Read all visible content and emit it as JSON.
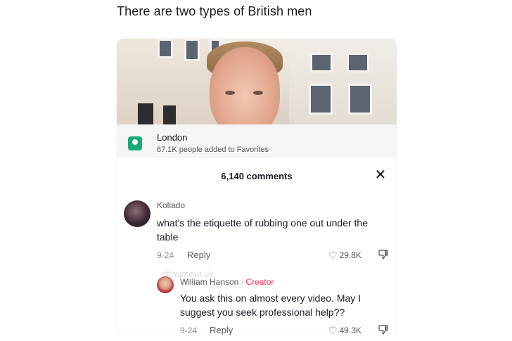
{
  "caption": "There are two types of British men",
  "location": {
    "title": "London",
    "subtitle": "67.1K people added to Favorites",
    "icon": "map-pin-icon",
    "color": "#19a974"
  },
  "comments_header": {
    "count_label": "6,140 comments",
    "close_label": "✕"
  },
  "comment": {
    "username": "Kollado",
    "text": "what's the etiquette of rubbing one out under the table",
    "date": "9-24",
    "reply_label": "Reply",
    "likes": "29.8K"
  },
  "reply": {
    "username": "William Hanson",
    "separator": "·",
    "badge": "Creator",
    "badge_color": "#fe2c55",
    "text": "You ask this on almost every video. May I suggest you seek professional help??",
    "date": "9-24",
    "reply_label": "Reply",
    "likes": "49.3K"
  },
  "watermark": "@humour.uk"
}
